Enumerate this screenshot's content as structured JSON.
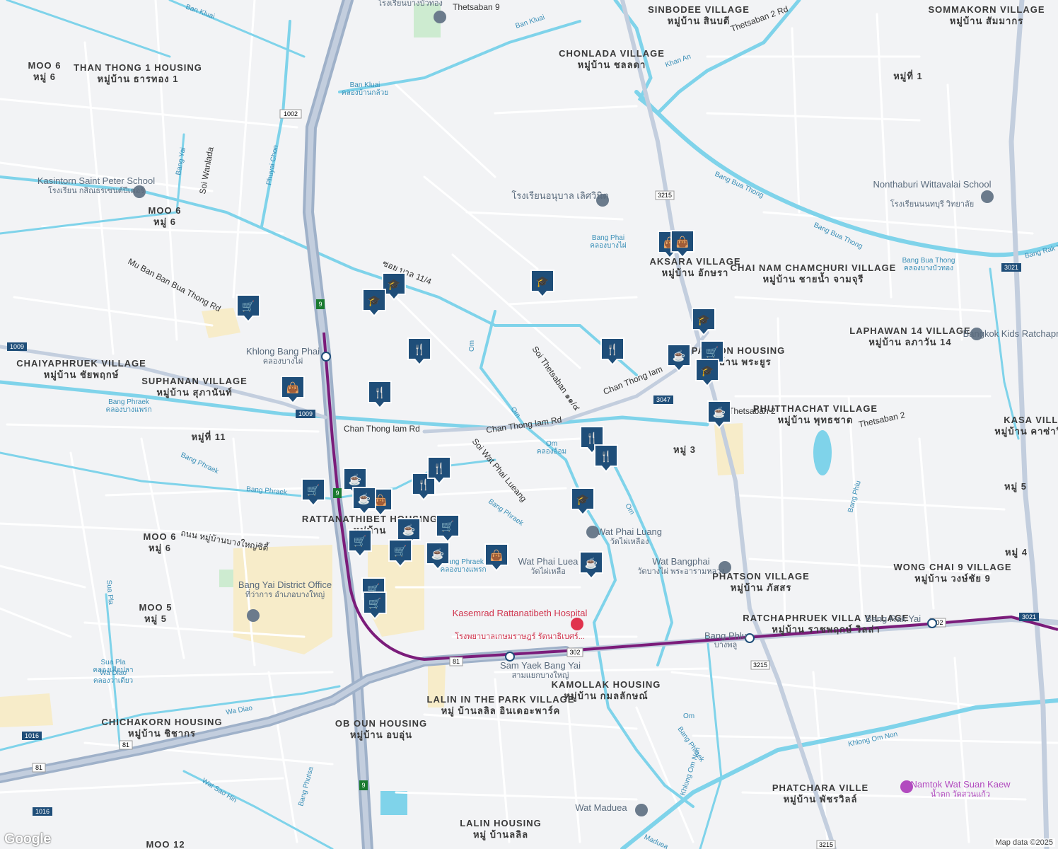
{
  "map": {
    "attribution": "Map data ©2025",
    "logo": "Google",
    "colors": {
      "background": "#f2f3f5",
      "water": "#7fd3ea",
      "minor_road": "#ffffff",
      "highway": "#9fb1c9",
      "rail": "#7b1c7a",
      "marker": "#1f4e79",
      "green": "#cdebd0",
      "urban": "#f7ecc9"
    }
  },
  "places": [
    {
      "name": "SINBODEE VILLAGE",
      "sub": "หมู่บ้าน สินบดี"
    },
    {
      "name": "SOMMAKORN VILLAGE",
      "sub": "หมู่บ้าน สัมมากร"
    },
    {
      "name": "CHONLADA VILLAGE",
      "sub": "หมู่บ้าน ชลลดา"
    },
    {
      "name": "THAN THONG 1 HOUSING",
      "sub": "หมู่บ้าน ธารทอง 1"
    },
    {
      "name": "MOO 6",
      "sub": "หมู่ 6"
    },
    {
      "name": "MOO 6",
      "sub": "หมู่ 6"
    },
    {
      "name": "AKSARA VILLAGE",
      "sub": "หมู่บ้าน อักษรา"
    },
    {
      "name": "CHAI NAM CHAMCHURI VILLAGE",
      "sub": "หมู่บ้าน ชายน้ำ จามจุรี"
    },
    {
      "name": "CHAIYAPHRUEK VILLAGE",
      "sub": "หมู่บ้าน ชัยพฤกษ์"
    },
    {
      "name": "SUPHANAN VILLAGE",
      "sub": "หมู่บ้าน สุภานันท์"
    },
    {
      "name": "LAPHAWAN 14 VILLAGE",
      "sub": "หมู่บ้าน ลภาวัน 14"
    },
    {
      "name": "PHUTTHACHAT VILLAGE",
      "sub": "หมู่บ้าน พุทธชาด"
    },
    {
      "name": "KASA VILLA",
      "sub": "หมู่บ้าน คาซ่าวิลล์"
    },
    {
      "name": "RATTANATHIBET HOUSING",
      "sub": "หมู่บ้าน"
    },
    {
      "name": "PHATSON VILLAGE",
      "sub": "หมู่บ้าน ภัสสร"
    },
    {
      "name": "WONG CHAI 9 VILLAGE",
      "sub": "หมู่บ้าน วงษ์ชัย 9"
    },
    {
      "name": "RATCHAPHRUEK VILLA VILLAGE",
      "sub": "หมู่บ้าน ราชพฤกษ์ วิลล่า"
    },
    {
      "name": "MOO 6",
      "sub": "หมู่ 6"
    },
    {
      "name": "MOO 5",
      "sub": "หมู่ 5"
    },
    {
      "name": "KAMOLLAK HOUSING",
      "sub": "หมู่บ้าน กมลลักษณ์"
    },
    {
      "name": "LALIN IN THE PARK VILLAGE",
      "sub": "หมู่ บ้านลลิล อินเดอะพาร์ค"
    },
    {
      "name": "CHICHAKORN HOUSING",
      "sub": "หมู่บ้าน ชิชากร"
    },
    {
      "name": "OB OUN HOUSING",
      "sub": "หมู่บ้าน อบอุ่น"
    },
    {
      "name": "PHATCHARA VILLE",
      "sub": "หมู่บ้าน พัชรวิลล์"
    },
    {
      "name": "LALIN HOUSING",
      "sub": "หมู่ บ้านลลิล"
    },
    {
      "name": "MOO 12",
      "sub": ""
    },
    {
      "name": "หมู่ที่ 1",
      "sub": ""
    },
    {
      "name": "หมู่ที่ 11",
      "sub": ""
    },
    {
      "name": "หมู่ 3",
      "sub": ""
    },
    {
      "name": "หมู่ 5",
      "sub": ""
    },
    {
      "name": "หมู่ 4",
      "sub": ""
    },
    {
      "name": "PAYOON HOUSING",
      "sub": "หมู่บ้าน พระยูร"
    }
  ],
  "pois": [
    {
      "name": "Kasintorn Saint Peter School",
      "sub": "โรงเรียน กสิณธรเซนต์ปีเตอร์"
    },
    {
      "name": "Nonthaburi Wittavalai School",
      "sub": "โรงเรียนนนทบุรี วิทยาลัย"
    },
    {
      "name": "โรงเรียนอนุบาล เลิศวินิต",
      "sub": ""
    },
    {
      "name": "Bangkok Kids Ratchapruek",
      "sub": ""
    },
    {
      "name": "Khlong Bang Phai",
      "sub": "คลองบางไผ่"
    },
    {
      "name": "Wat Phai Luang",
      "sub": "วัดไผ่เหลือง"
    },
    {
      "name": "Wat Phai Luea",
      "sub": "วัดไผ่เหลือ"
    },
    {
      "name": "Wat Bangphai",
      "sub": "วัดบางไผ่ พระอารามหลวง"
    },
    {
      "name": "Bang Yai District Office",
      "sub": "ที่ว่าการ อำเภอบางใหญ่"
    },
    {
      "name": "Kasemrad Rattanatibeth Hospital",
      "sub": "โรงพยาบาลเกษมราษฎร์ รัตนาธิเบศร์..."
    },
    {
      "name": "Sam Yaek Bang Yai",
      "sub": "สามแยกบางใหญ่"
    },
    {
      "name": "Bang Phlu",
      "sub": "บางพลู"
    },
    {
      "name": "Bang Rak Yai",
      "sub": "บางรักใหญ่"
    },
    {
      "name": "Wat Maduea",
      "sub": "วัดมะเดื่อ"
    },
    {
      "name": "Namtok Wat Suan Kaew",
      "sub": "น้ำตก วัดสวนแก้ว"
    },
    {
      "name": "โรงเรียนบางบัวทอง",
      "sub": ""
    }
  ],
  "roads": {
    "chan_thong_iam_1": "Chan Thong Iam Rd",
    "chan_thong_iam_2": "Chan Thong Iam Rd",
    "chan_thong_iam_3": "Chan Thong Iam",
    "mu_ban_bua_thong": "Mu Ban Ban Bua Thong Rd",
    "soi_wat_phai_lueang": "Soi Wat Phai Lueang",
    "soi_thetsaban": "Soi Thetsaban ๑๑/๔",
    "thetsaban_2": "Thetsaban 2",
    "thetsaban_2b": "Thetsaban 2",
    "thetsaban_2_rd": "Thetsaban 2 Rd",
    "soi_wanlada": "Soi Wanlada",
    "soi_11_4": "ซอย บาล 11/4",
    "thanon_bang_yai": "ถนน หมู่บ้านบางใหญ่ซิตี้",
    "thetsaban_9": "Thetsaban 9"
  },
  "waterways": {
    "bang_bua_thong": "Bang Bua Thong",
    "bang_bua_thong_2": "Bang Bua Thong",
    "bang_bua_thong_canal": "Bang Bua Thong",
    "bang_bua_thong_canal_th": "คลองบางบัวทอง",
    "ban_kluai_1": "Ban Kluai",
    "ban_kluai_2": "Ban Kluai",
    "ban_kluai_canal": "Ban Kluai",
    "ban_kluai_canal_th": "คลองบ้านกล้วย",
    "khan_an": "Khan An",
    "phuyai_chon": "Phuyai Chon",
    "bang_yai": "Bang Yai",
    "bang_phai": "Bang Phai",
    "bang_phai_th": "คลองบางไผ่",
    "bang_phraek_1": "Bang Phraek",
    "bang_phraek_1_th": "คลองบางแพรก",
    "bang_phraek_2": "Bang Phraek",
    "bang_phraek_3": "Bang Phraek",
    "bang_phraek_4": "Bang Phraek",
    "bang_phraek_5": "Bang Phraek",
    "bang_phraek_5_th": "คลองบางแพรก",
    "bang_phraek_6": "Bang Phraek",
    "om_1": "Om",
    "om_2": "Om",
    "om_3": "Om",
    "om_4": "Om",
    "om_4_th": "คลองอ้อม",
    "om_5": "Om",
    "bang_phlu": "Bang Phlu",
    "bang_rak_yai": "Bang Rak Yai",
    "khlong_om_non": "Khlong Om Non",
    "khlong_om_non_2": "Khlong Om Non",
    "sua_pla_1": "Sua Pla",
    "sua_pla_2": "Sua Pla",
    "sua_pla_th": "คลองเสือปลา",
    "wa_diao_1": "Wa Diao",
    "wa_diao_th": "คลองวาเดียว",
    "wa_diao_2": "Wa Diao",
    "wat_sao_hin": "Wat Sao Hin",
    "bang_phutsa": "Bang Phutsa",
    "maduea": "Maduea"
  },
  "shields": {
    "r1002": "1002",
    "r3215": "3215",
    "r3215b": "3215",
    "r3215c": "3215",
    "r3021": "3021",
    "r3021b": "3021",
    "r1009a": "1009",
    "r1009b": "1009",
    "r3047": "3047",
    "r302a": "302",
    "r302b": "302",
    "r81a": "81",
    "r81b": "81",
    "r81c": "81",
    "r1016a": "1016",
    "r1016b": "1016",
    "r9a": "9",
    "r9b": "9",
    "r9c": "9"
  },
  "markers": [
    {
      "type": "shopping-cart-icon"
    },
    {
      "type": "school-icon"
    },
    {
      "type": "school-icon"
    },
    {
      "type": "school-icon"
    },
    {
      "type": "restaurant-icon"
    },
    {
      "type": "restaurant-icon"
    },
    {
      "type": "restaurant-icon"
    },
    {
      "type": "shopping-bag-icon"
    },
    {
      "type": "shopping-bag-icon"
    },
    {
      "type": "school-icon"
    },
    {
      "type": "cafe-icon"
    },
    {
      "type": "shopping-cart-icon"
    },
    {
      "type": "school-icon"
    },
    {
      "type": "cafe-icon"
    },
    {
      "type": "restaurant-icon"
    },
    {
      "type": "restaurant-icon"
    },
    {
      "type": "school-icon"
    },
    {
      "type": "cafe-icon"
    },
    {
      "type": "shopping-cart-icon"
    },
    {
      "type": "cafe-icon"
    },
    {
      "type": "shopping-bag-icon"
    },
    {
      "type": "restaurant-icon"
    },
    {
      "type": "restaurant-icon"
    },
    {
      "type": "cafe-icon"
    },
    {
      "type": "shopping-cart-icon"
    },
    {
      "type": "shopping-cart-icon"
    },
    {
      "type": "shopping-cart-icon"
    },
    {
      "type": "cafe-icon"
    },
    {
      "type": "shopping-bag-icon"
    },
    {
      "type": "shopping-cart-icon"
    },
    {
      "type": "shopping-cart-icon"
    },
    {
      "type": "cafe-icon"
    },
    {
      "type": "shopping-bag-icon"
    }
  ]
}
